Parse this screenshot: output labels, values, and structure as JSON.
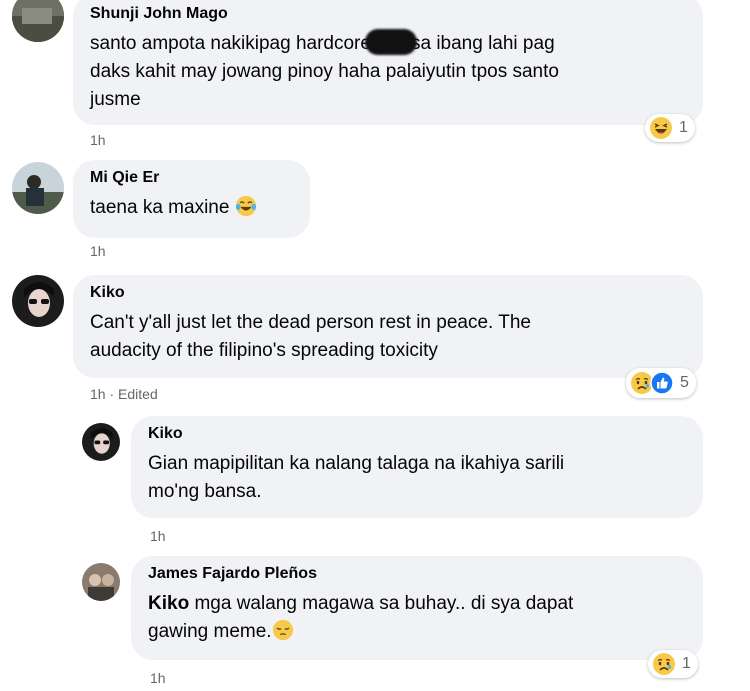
{
  "comments": [
    {
      "author": "Shunji John Mago",
      "text_lines": [
        "santo ampota nakikipag hardcore",
        "sa ibang lahi pag",
        "daks kahit may jowang pinoy haha palaiyutin tpos santo",
        "jusme"
      ],
      "time": "1h",
      "reaction_count": "1",
      "reaction_icons": [
        "haha-icon"
      ]
    },
    {
      "author": "Mi Qie Er",
      "text": "taena ka maxine",
      "text_emoji": "crying-laughing-emoji",
      "time": "1h"
    },
    {
      "author": "Kiko",
      "text_lines": [
        "Can't y'all just let the dead person rest in peace. The",
        "audacity of the filipino's spreading toxicity"
      ],
      "time": "1h",
      "edited_label": "Edited",
      "reaction_count": "5",
      "reaction_icons": [
        "sad-icon",
        "like-icon"
      ]
    }
  ],
  "replies": [
    {
      "author": "Kiko",
      "text_lines": [
        "Gian mapipilitan ka nalang talaga na ikahiya sarili",
        "mo'ng bansa."
      ],
      "time": "1h"
    },
    {
      "author": "James Fajardo Pleños",
      "mention": "Kiko",
      "text_lines": [
        " mga walang magawa sa buhay.. di sya dapat",
        "gawing meme."
      ],
      "text_emoji": "pensive-emoji",
      "time": "1h",
      "reaction_count": "1",
      "reaction_icons": [
        "sad-icon"
      ]
    }
  ],
  "colors": {
    "bubble": "#f0f2f5",
    "meta_text": "#65676b",
    "like_blue": "#1877f2",
    "emoji_yellow": "#f7c94b"
  }
}
